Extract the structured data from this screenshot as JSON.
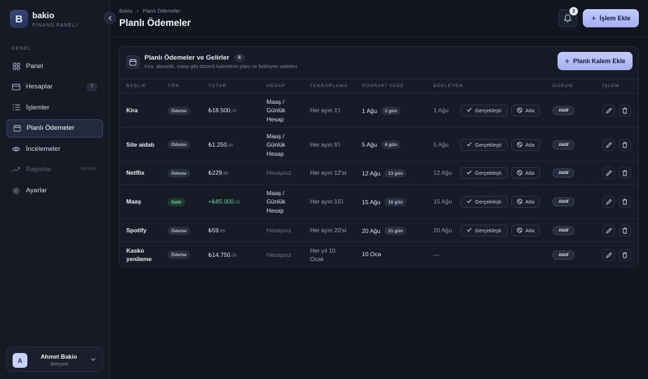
{
  "brand": {
    "logo_letter": "B",
    "name": "bakio",
    "subtitle": "FİNANS PANELİ"
  },
  "nav": {
    "section_label": "GENEL",
    "items": [
      {
        "label": "Panel",
        "icon": "grid-icon"
      },
      {
        "label": "Hesaplar",
        "icon": "card-icon",
        "badge": "7"
      },
      {
        "label": "İşlemler",
        "icon": "list-icon"
      },
      {
        "label": "Planlı Ödemeler",
        "icon": "calendar-icon",
        "active": true
      },
      {
        "label": "İncelemeler",
        "icon": "eye-icon"
      },
      {
        "label": "Raporlar",
        "icon": "trend-icon",
        "soon": "Yakında",
        "disabled": true
      },
      {
        "label": "Ayarlar",
        "icon": "gear-icon"
      }
    ]
  },
  "user": {
    "initial": "A",
    "name": "Ahmet Bakio",
    "role": "Bireysel"
  },
  "header": {
    "breadcrumb": [
      "Bakio",
      "Planlı Ödemeler"
    ],
    "title": "Planlı Ödemeler",
    "notification_count": "3",
    "primary_button": "İşlem Ekle"
  },
  "card": {
    "title": "Planlı Ödemeler ve Gelirler",
    "count": "6",
    "subtitle": "Kira, abonelik, maaş gibi düzenli kalemlerin planı ve bekleyen vadeleri",
    "add_button": "Planlı Kalem Ekle"
  },
  "table": {
    "columns": [
      "BAŞLIK",
      "YÖN",
      "TUTAR",
      "HESAP",
      "TEKRARLAMA",
      "SONRAKİ VADE",
      "BEKLEYEN",
      "DURUM",
      "İŞLEM"
    ],
    "action_done": "Gerçekleşti",
    "action_skip": "Atla",
    "rows": [
      {
        "title": [
          "Kira"
        ],
        "direction": "Ödeme",
        "amount": "₺18.500",
        "cents": ",00",
        "account": [
          "Maaş /",
          "Günlük",
          "Hesap"
        ],
        "repeat": [
          "Her ayın 1'i"
        ],
        "due": "1 Ağu",
        "days": "2 gün",
        "pending": "1 Ağu",
        "status": "Aktif"
      },
      {
        "title": [
          "Site aidatı"
        ],
        "direction": "Ödeme",
        "amount": "₺1.250",
        "cents": ",00",
        "account": [
          "Maaş /",
          "Günlük",
          "Hesap"
        ],
        "repeat": [
          "Her ayın 5'i"
        ],
        "due": "5 Ağu",
        "days": "6 gün",
        "pending": "5 Ağu",
        "status": "Aktif"
      },
      {
        "title": [
          "Netflix"
        ],
        "direction": "Ödeme",
        "amount": "₺229",
        "cents": ",99",
        "account": [
          "Hesapsız"
        ],
        "repeat": [
          "Her ayın 12'si"
        ],
        "due": "12 Ağu",
        "days": "13 gün",
        "pending": "12 Ağu",
        "status": "Aktif"
      },
      {
        "title": [
          "Maaş"
        ],
        "direction": "Gelir",
        "amount": "+₺85.000",
        "cents": ",00",
        "account": [
          "Maaş /",
          "Günlük",
          "Hesap"
        ],
        "repeat": [
          "Her ayın 15'i"
        ],
        "due": "15 Ağu",
        "days": "16 gün",
        "pending": "15 Ağu",
        "status": "Aktif"
      },
      {
        "title": [
          "Spotify"
        ],
        "direction": "Ödeme",
        "amount": "₺59",
        "cents": ",99",
        "account": [
          "Hesapsız"
        ],
        "repeat": [
          "Her ayın 20'si"
        ],
        "due": "20 Ağu",
        "days": "21 gün",
        "pending": "20 Ağu",
        "status": "Aktif"
      },
      {
        "title": [
          "Kasko",
          "yenileme"
        ],
        "direction": "Ödeme",
        "amount": "₺14.750",
        "cents": ",00",
        "account": [
          "Hesapsız"
        ],
        "repeat": [
          "Her yıl 10",
          "Ocak"
        ],
        "due": "10 Oca",
        "days": "",
        "pending": "—",
        "status": "Aktif"
      }
    ]
  }
}
